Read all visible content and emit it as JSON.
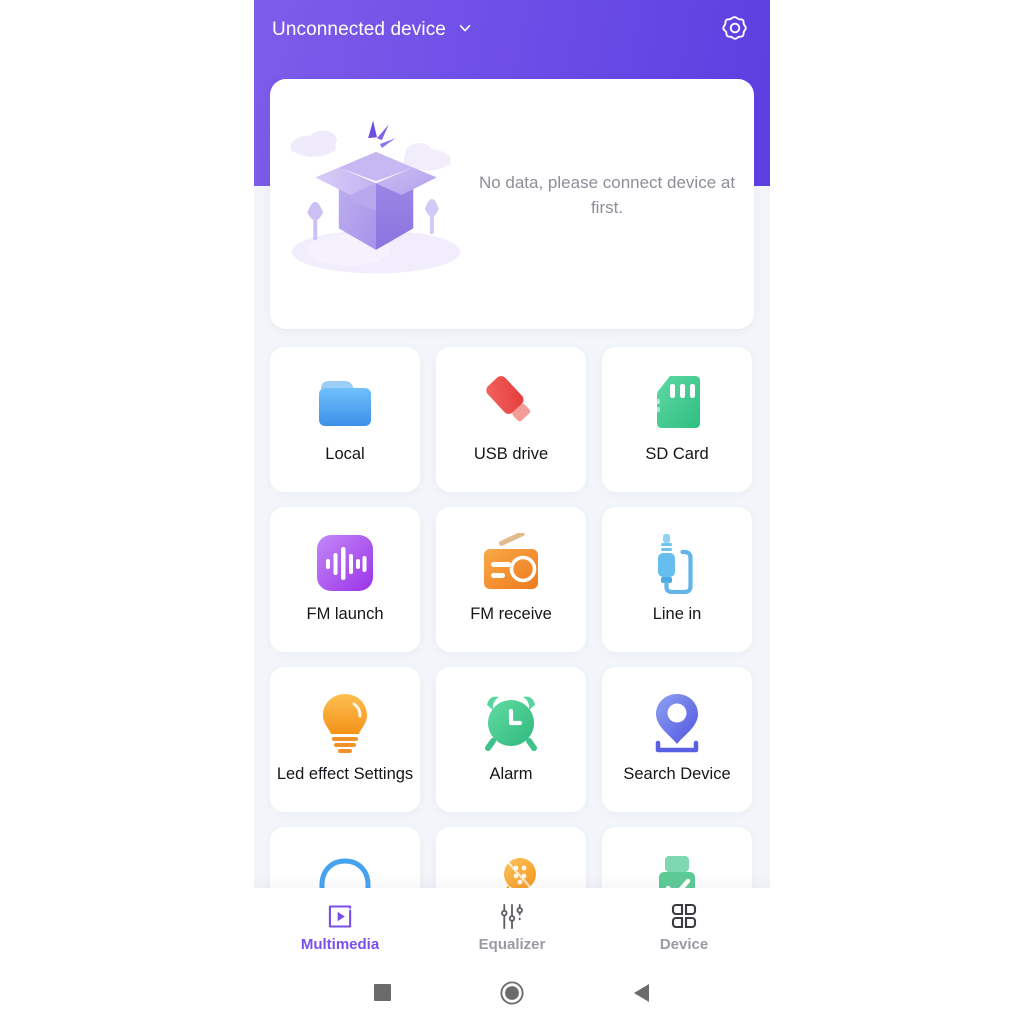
{
  "header": {
    "device_name": "Unconnected device",
    "chevron_icon": "chevron-down-icon",
    "settings_icon": "gear-icon",
    "gradient_from": "#7E5CEA",
    "gradient_to": "#5B3FE0"
  },
  "empty_state": {
    "message": "No data, please connect device at first.",
    "illustration": "empty-box-illustration",
    "text_color": "#8E8E98"
  },
  "grid": {
    "tiles": [
      {
        "label": "Local",
        "icon": "folder-icon",
        "color": "#4EA6F5"
      },
      {
        "label": "USB drive",
        "icon": "usb-drive-icon",
        "color": "#EF4B4B"
      },
      {
        "label": "SD Card",
        "icon": "sd-card-icon",
        "color": "#3FCB8E"
      },
      {
        "label": "FM launch",
        "icon": "sound-bars-icon",
        "color": "#A855F7"
      },
      {
        "label": "FM receive",
        "icon": "radio-icon",
        "color": "#F3932F"
      },
      {
        "label": "Line in",
        "icon": "audio-jack-icon",
        "color": "#5BB5E8"
      },
      {
        "label": "Led effect Settings",
        "icon": "lightbulb-icon",
        "color": "#F8A72A"
      },
      {
        "label": "Alarm",
        "icon": "alarm-clock-icon",
        "color": "#45C98A"
      },
      {
        "label": "Search Device",
        "icon": "map-pin-icon",
        "color": "#6366E8"
      },
      {
        "label": "",
        "icon": "headphones-icon",
        "color": "#46A3F0"
      },
      {
        "label": "",
        "icon": "microphone-icon",
        "color": "#F5A623"
      },
      {
        "label": "",
        "icon": "device-check-icon",
        "color": "#5DCB96"
      }
    ]
  },
  "tabbar": {
    "active_color": "#7B4FEA",
    "inactive_color": "#9A9AA4",
    "tabs": [
      {
        "label": "Multimedia",
        "icon": "play-square-icon",
        "active": true
      },
      {
        "label": "Equalizer",
        "icon": "equalizer-icon",
        "active": false
      },
      {
        "label": "Device",
        "icon": "grid-four-icon",
        "active": false
      }
    ]
  },
  "system_nav": {
    "buttons": [
      {
        "icon": "recents-square-icon"
      },
      {
        "icon": "home-circle-icon"
      },
      {
        "icon": "back-triangle-icon"
      }
    ]
  }
}
